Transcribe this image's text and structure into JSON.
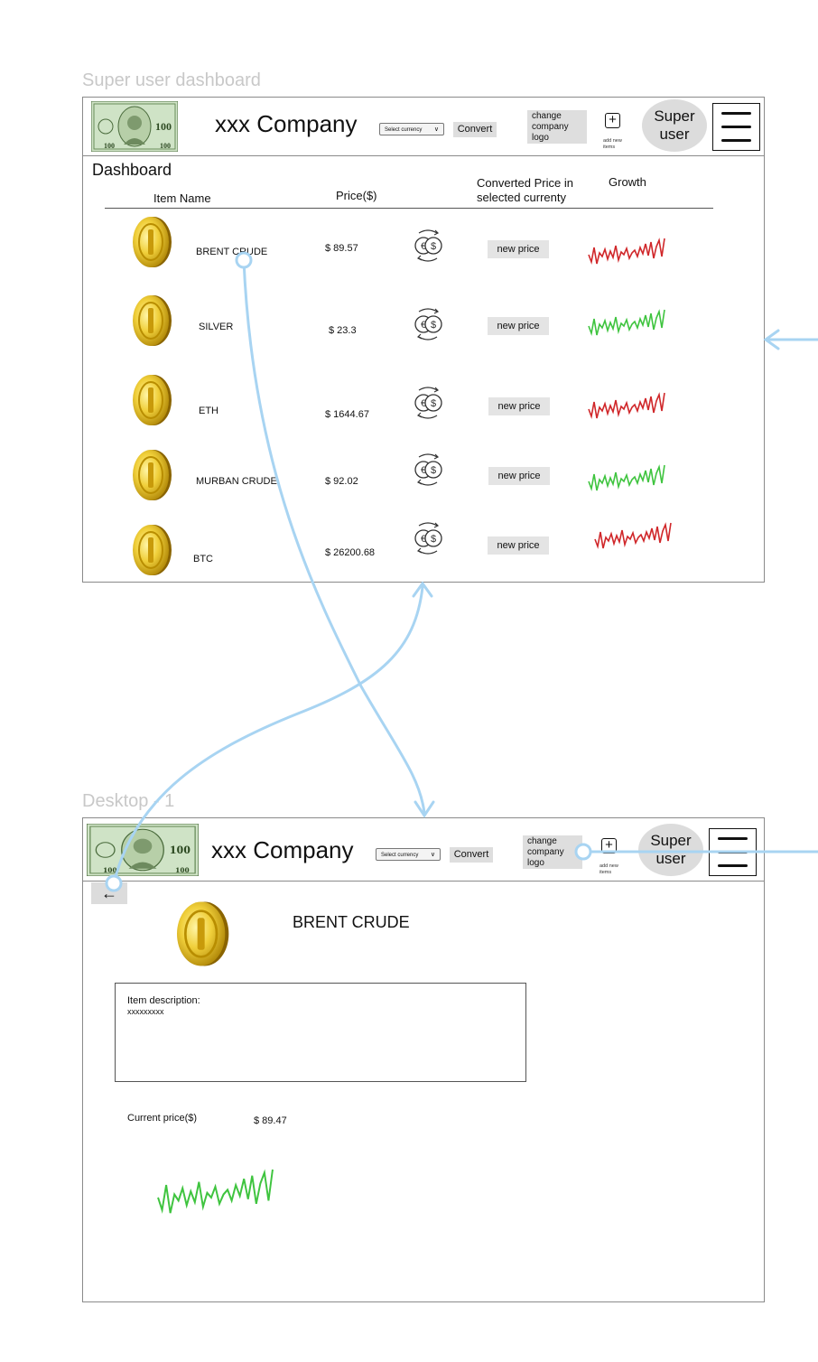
{
  "frames": {
    "dashboard_label": "Super user dashboard",
    "detail_label": "Desktop - 1"
  },
  "header": {
    "company_name": "xxx Company",
    "currency_select": "Select currency",
    "convert_label": "Convert",
    "change_logo_label": "change company logo",
    "add_items_label": "add new items",
    "super_user_label": "Super user",
    "logo_icon": "dollar-bill-logo",
    "menu_icon": "hamburger-menu-icon"
  },
  "dashboard": {
    "title": "Dashboard",
    "columns": {
      "item_name": "Item Name",
      "price": "Price($)",
      "converted": "Converted Price in selected currenty",
      "growth": "Growth"
    },
    "rows": [
      {
        "name": "BRENT CRUDE",
        "price": "$ 89.57",
        "new_price": "new price",
        "growth_color": "#d0272a"
      },
      {
        "name": "SILVER",
        "price": "$ 23.3",
        "new_price": "new price",
        "growth_color": "#3fc43f"
      },
      {
        "name": "ETH",
        "price": "$ 1644.67",
        "new_price": "new price",
        "growth_color": "#d0272a"
      },
      {
        "name": "MURBAN CRUDE",
        "price": "$ 92.02",
        "new_price": "new price",
        "growth_color": "#3fc43f"
      },
      {
        "name": "BTC",
        "price": "$ 26200.68",
        "new_price": "new price",
        "growth_color": "#d0272a"
      }
    ]
  },
  "detail": {
    "back_icon": "back-arrow-icon",
    "item_title": "BRENT CRUDE",
    "description_label": "Item description:",
    "description_value": "xxxxxxxxx",
    "current_price_label": "Current price($)",
    "current_price_value": "$ 89.47",
    "growth_color": "#3fc43f"
  },
  "colors": {
    "flow_arrow": "#a8d4f2",
    "coin_gold": "#e8c535",
    "button_grey": "#dedede"
  }
}
